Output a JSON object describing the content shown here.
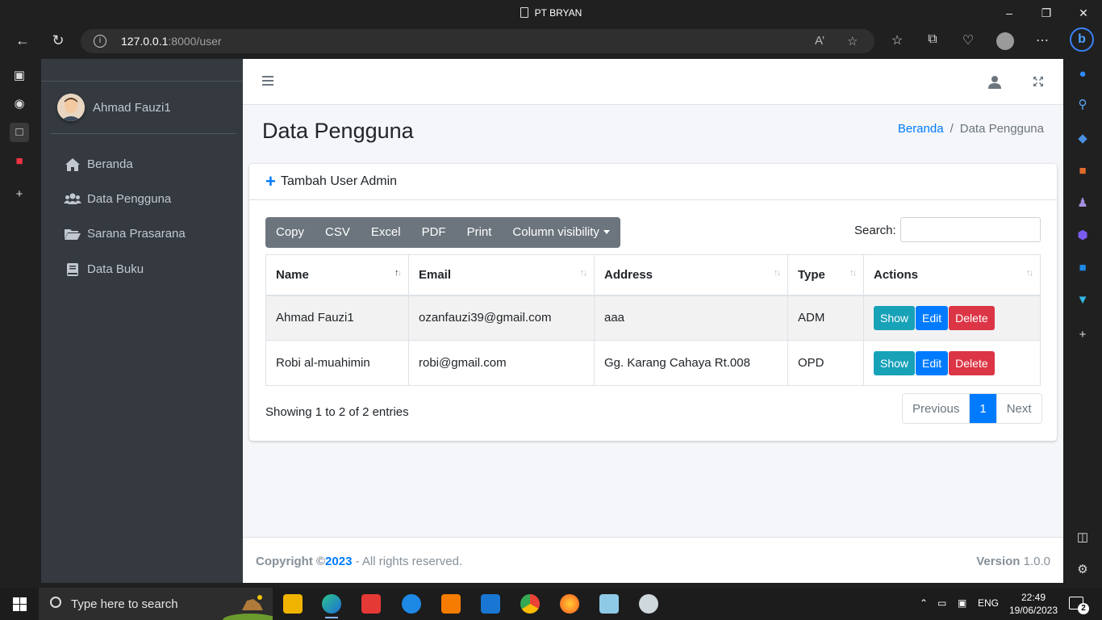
{
  "browser": {
    "window_title": "PT BRYAN",
    "url_host": "127.0.0.1",
    "url_path": ":8000/user"
  },
  "sidebar": {
    "user_name": "Ahmad Fauzi1",
    "items": [
      {
        "label": "Beranda",
        "icon": "home-icon"
      },
      {
        "label": "Data Pengguna",
        "icon": "users-icon"
      },
      {
        "label": "Sarana Prasarana",
        "icon": "folder-open-icon"
      },
      {
        "label": "Data Buku",
        "icon": "book-icon"
      }
    ]
  },
  "header": {
    "page_title": "Data Pengguna",
    "breadcrumb": [
      "Beranda",
      "Data Pengguna"
    ]
  },
  "card": {
    "header_text": "Tambah User Admin",
    "export_buttons": [
      "Copy",
      "CSV",
      "Excel",
      "PDF",
      "Print",
      "Column visibility"
    ],
    "search_label": "Search:",
    "search_value": ""
  },
  "table": {
    "columns": [
      "Name",
      "Email",
      "Address",
      "Type",
      "Actions"
    ],
    "rows": [
      {
        "name": "Ahmad Fauzi1",
        "email": "ozanfauzi39@gmail.com",
        "address": "aaa",
        "type": "ADM"
      },
      {
        "name": "Robi al-muahimin",
        "email": "robi@gmail.com",
        "address": "Gg. Karang Cahaya Rt.008",
        "type": "OPD"
      }
    ],
    "actions": {
      "show": "Show",
      "edit": "Edit",
      "delete": "Delete"
    }
  },
  "pagination": {
    "info": "Showing 1 to 2 of 2 entries",
    "previous": "Previous",
    "current": "1",
    "next": "Next"
  },
  "footer": {
    "copyright_prefix": "Copyright ©",
    "year": "2023",
    "copyright_suffix": " - All rights reserved.",
    "version_label": "Version",
    "version_value": "1.0.0"
  },
  "taskbar": {
    "search_placeholder": "Type here to search",
    "language": "ENG",
    "time": "22:49",
    "date": "19/06/2023",
    "notification_count": "2"
  },
  "colors": {
    "primary": "#007bff",
    "info": "#17a2b8",
    "danger": "#dc3545",
    "secondary": "#6c757d",
    "sidebar": "#343a40"
  }
}
